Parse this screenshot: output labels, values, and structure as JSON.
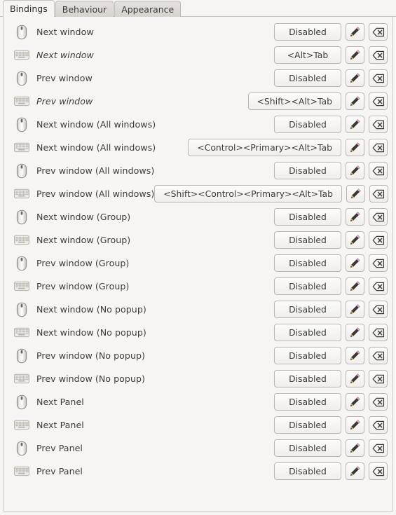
{
  "tabs": [
    {
      "label": "Bindings",
      "active": true
    },
    {
      "label": "Behaviour",
      "active": false
    },
    {
      "label": "Appearance",
      "active": false
    }
  ],
  "colors": {
    "background": "#f6f5f4",
    "panel_border": "#cbc7c2",
    "text": "#3d3d3d",
    "button_border": "#bbb6b1",
    "pencil_body": "#3a3632",
    "pencil_eraser": "#e9a9d6",
    "pencil_tip": "#e8cf92"
  },
  "icons": {
    "mouse": "mouse-icon",
    "keyboard": "keyboard-icon",
    "edit": "pencil-icon",
    "clear": "backspace-clear-icon"
  },
  "buttons": {
    "edit_label": "Edit binding",
    "clear_label": "Clear binding"
  },
  "bindings": [
    {
      "device": "mouse",
      "label": "Next window",
      "italic": false,
      "value": "Disabled"
    },
    {
      "device": "keyboard",
      "label": "Next window",
      "italic": true,
      "value": "<Alt>Tab"
    },
    {
      "device": "mouse",
      "label": "Prev window",
      "italic": false,
      "value": "Disabled"
    },
    {
      "device": "keyboard",
      "label": "Prev window",
      "italic": true,
      "value": "<Shift><Alt>Tab"
    },
    {
      "device": "mouse",
      "label": "Next window (All windows)",
      "italic": false,
      "value": "Disabled"
    },
    {
      "device": "keyboard",
      "label": "Next window (All windows)",
      "italic": false,
      "value": "<Control><Primary><Alt>Tab"
    },
    {
      "device": "mouse",
      "label": "Prev window (All windows)",
      "italic": false,
      "value": "Disabled"
    },
    {
      "device": "keyboard",
      "label": "Prev window (All windows)",
      "italic": false,
      "value": "<Shift><Control><Primary><Alt>Tab"
    },
    {
      "device": "mouse",
      "label": "Next window (Group)",
      "italic": false,
      "value": "Disabled"
    },
    {
      "device": "keyboard",
      "label": "Next window (Group)",
      "italic": false,
      "value": "Disabled"
    },
    {
      "device": "mouse",
      "label": "Prev window (Group)",
      "italic": false,
      "value": "Disabled"
    },
    {
      "device": "keyboard",
      "label": "Prev window (Group)",
      "italic": false,
      "value": "Disabled"
    },
    {
      "device": "mouse",
      "label": "Next window (No popup)",
      "italic": false,
      "value": "Disabled"
    },
    {
      "device": "keyboard",
      "label": "Next window (No popup)",
      "italic": false,
      "value": "Disabled"
    },
    {
      "device": "mouse",
      "label": "Prev window (No popup)",
      "italic": false,
      "value": "Disabled"
    },
    {
      "device": "keyboard",
      "label": "Prev window (No popup)",
      "italic": false,
      "value": "Disabled"
    },
    {
      "device": "mouse",
      "label": "Next Panel",
      "italic": false,
      "value": "Disabled"
    },
    {
      "device": "keyboard",
      "label": "Next Panel",
      "italic": false,
      "value": "Disabled"
    },
    {
      "device": "mouse",
      "label": "Prev Panel",
      "italic": false,
      "value": "Disabled"
    },
    {
      "device": "keyboard",
      "label": "Prev Panel",
      "italic": false,
      "value": "Disabled"
    }
  ]
}
